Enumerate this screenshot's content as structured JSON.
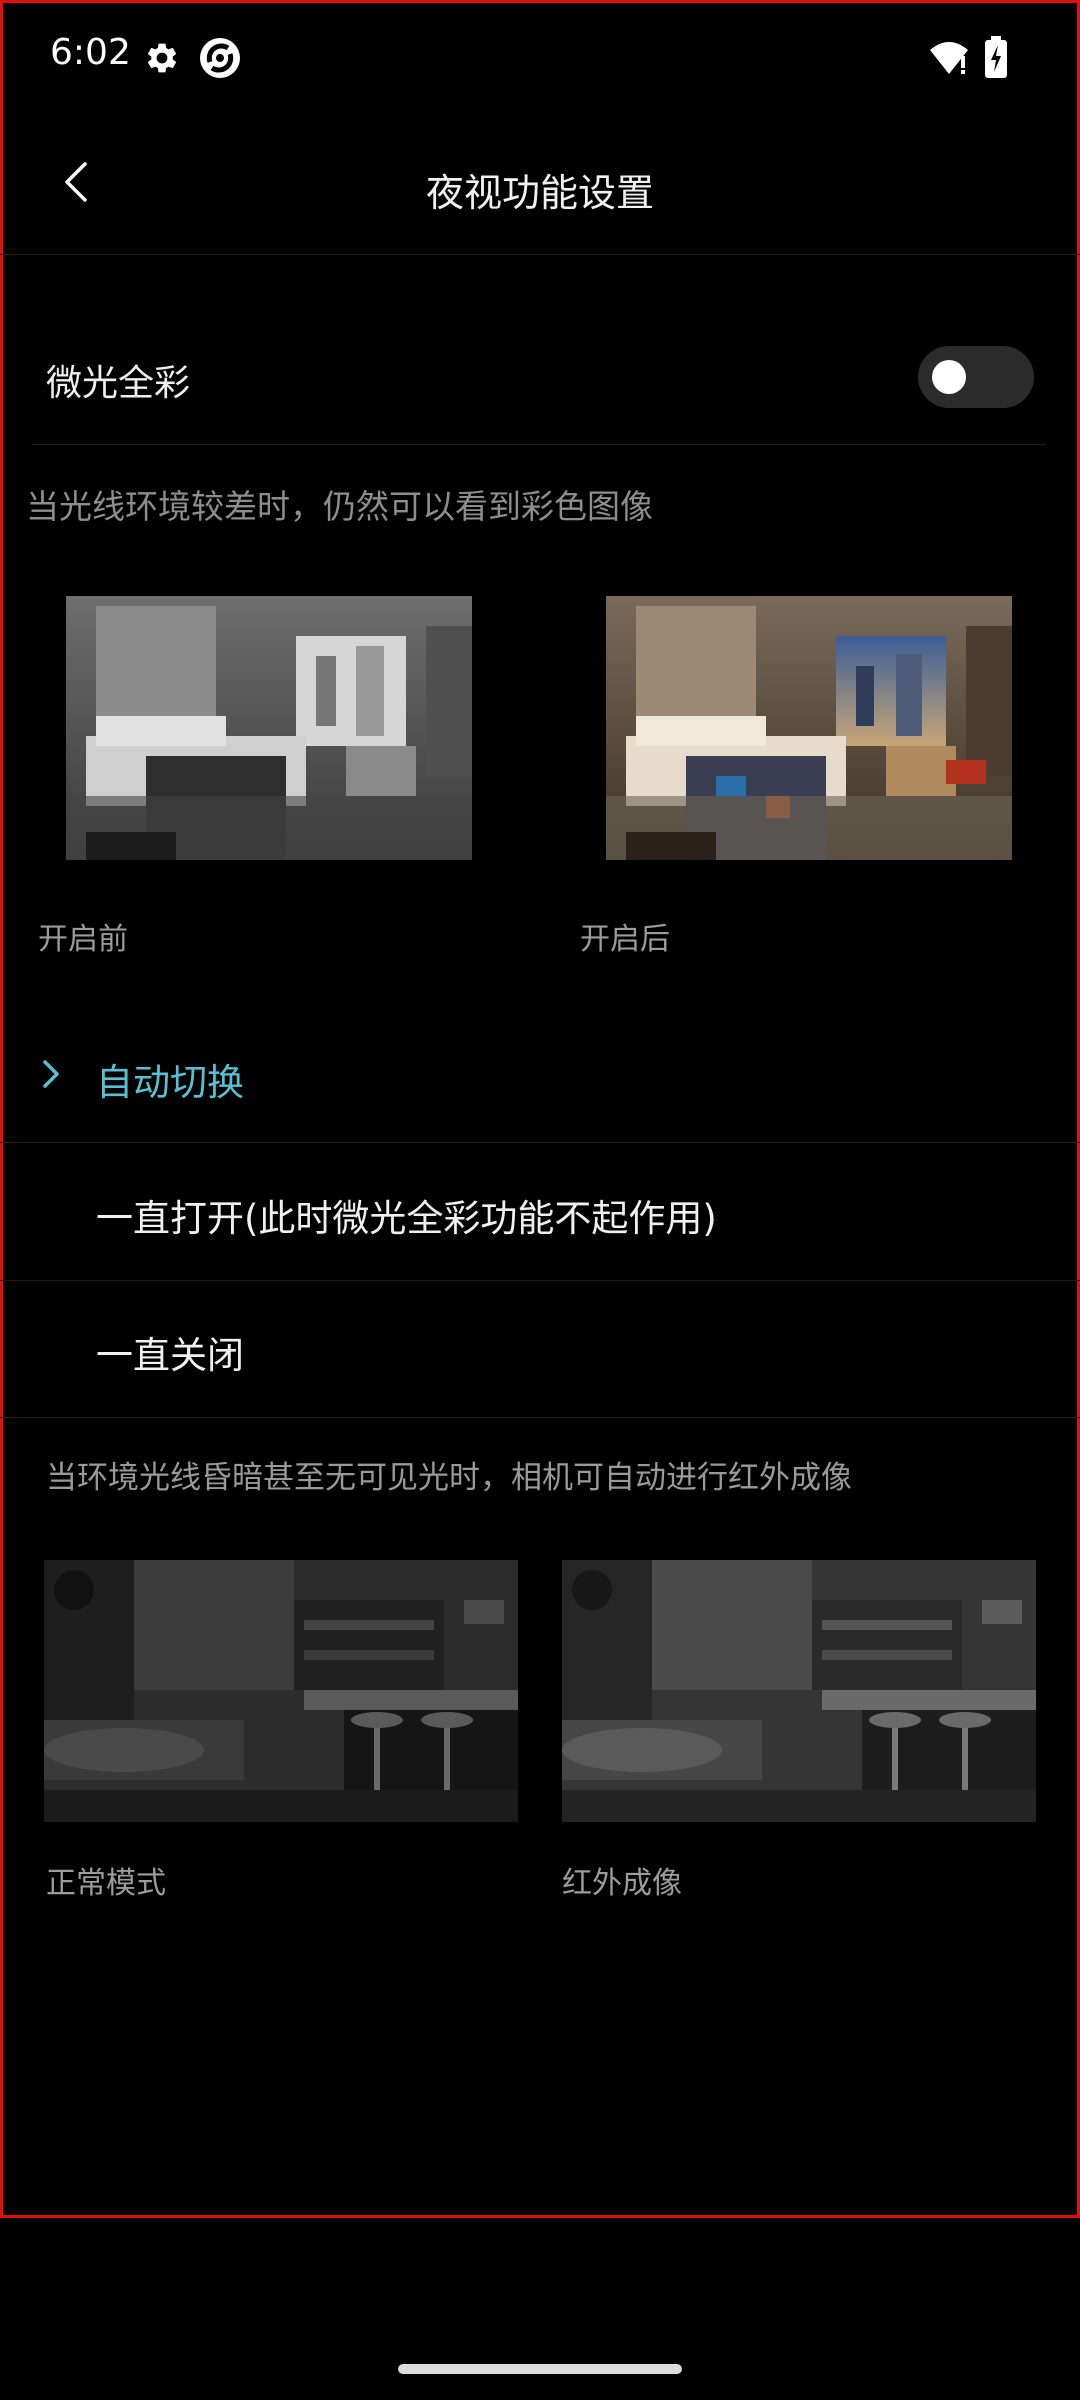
{
  "status_bar": {
    "time": "6:02",
    "icons": [
      "gear-icon",
      "app-icon",
      "wifi-alert-icon",
      "battery-charging-icon"
    ]
  },
  "header": {
    "title": "夜视功能设置",
    "back_icon": "chevron-left-icon"
  },
  "low_light_color": {
    "label": "微光全彩",
    "toggle_on": false,
    "description": "当光线环境较差时，仍然可以看到彩色图像",
    "before_caption": "开启前",
    "after_caption": "开启后"
  },
  "night_mode": {
    "options": [
      {
        "label": "自动切换",
        "selected": true
      },
      {
        "label": "一直打开(此时微光全彩功能不起作用)",
        "selected": false
      },
      {
        "label": "一直关闭",
        "selected": false
      }
    ],
    "description": "当环境光线昏暗甚至无可见光时，相机可自动进行红外成像",
    "normal_caption": "正常模式",
    "infrared_caption": "红外成像"
  },
  "colors": {
    "accent": "#5bbfd3",
    "background": "#000000",
    "frame_border": "#e01010"
  }
}
